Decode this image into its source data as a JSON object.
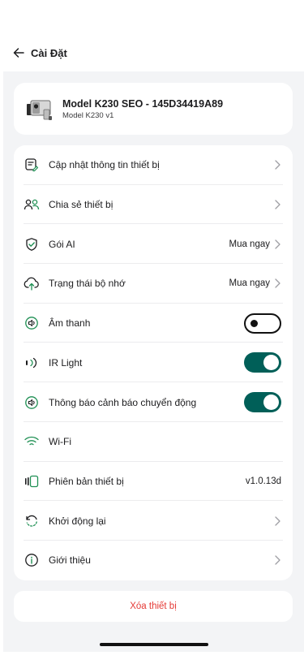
{
  "header": {
    "title": "Cài Đặt",
    "back_icon": "arrow-left-icon"
  },
  "device": {
    "name": "Model K230 SEO - 145D34419A89",
    "model": "Model K230 v1",
    "icon": "camera-icon"
  },
  "menu": [
    {
      "label": "Cập nhật thông tin thiết bị",
      "icon": "edit-info-icon",
      "control": "chevron"
    },
    {
      "label": "Chia sẻ thiết bị",
      "icon": "users-share-icon",
      "control": "chevron"
    },
    {
      "label": "Gói AI",
      "icon": "shield-check-icon",
      "control": "chevron",
      "value": "Mua ngay"
    },
    {
      "label": "Trạng thái bộ nhớ",
      "icon": "cloud-storage-icon",
      "control": "chevron",
      "value": "Mua ngay"
    },
    {
      "label": "Âm thanh",
      "icon": "speaker-icon",
      "control": "toggle",
      "state": "off"
    },
    {
      "label": "IR Light",
      "icon": "ir-light-icon",
      "control": "toggle",
      "state": "on"
    },
    {
      "label": "Thông báo cảnh báo chuyển động",
      "icon": "motion-alert-icon",
      "control": "toggle",
      "state": "on"
    },
    {
      "label": "Wi-Fi",
      "icon": "wifi-icon",
      "control": "none"
    },
    {
      "label": "Phiên bản thiết bị",
      "icon": "firmware-icon",
      "control": "value",
      "value": "v1.0.13d"
    },
    {
      "label": "Khởi động lại",
      "icon": "restart-icon",
      "control": "chevron"
    },
    {
      "label": "Giới thiệu",
      "icon": "info-icon",
      "control": "chevron"
    }
  ],
  "delete_label": "Xóa thiết bị",
  "colors": {
    "accent": "#005f58",
    "danger": "#e53935",
    "background": "#f3f4f6"
  }
}
